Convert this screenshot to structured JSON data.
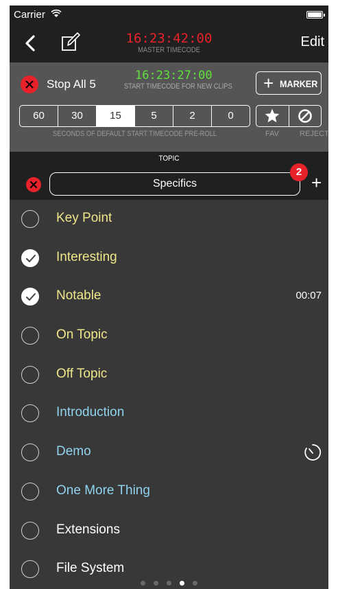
{
  "status_bar": {
    "carrier": "Carrier"
  },
  "nav": {
    "master_timecode": "16:23:42:00",
    "master_timecode_label": "MASTER TIMECODE",
    "edit_label": "Edit"
  },
  "controls": {
    "stop_all_label": "Stop All 5",
    "start_timecode": "16:23:27:00",
    "start_timecode_label": "START TIMECODE FOR NEW CLIPS",
    "marker_label": "MARKER",
    "preroll_options": [
      "60",
      "30",
      "15",
      "5",
      "2",
      "0"
    ],
    "preroll_selected": "15",
    "preroll_label": "SECONDS OF DEFAULT START TIMECODE PRE-ROLL",
    "fav_label": "FAV",
    "reject_label": "REJECT"
  },
  "topic": {
    "heading": "TOPIC",
    "value": "Specifics",
    "badge_count": "2"
  },
  "items": [
    {
      "label": "Key Point",
      "checked": false,
      "color": "#f0e68a",
      "time": "",
      "timer": false
    },
    {
      "label": "Interesting",
      "checked": true,
      "color": "#f0e68a",
      "time": "",
      "timer": false
    },
    {
      "label": "Notable",
      "checked": true,
      "color": "#f0e68a",
      "time": "00:07",
      "timer": false
    },
    {
      "label": "On Topic",
      "checked": false,
      "color": "#f0e68a",
      "time": "",
      "timer": false
    },
    {
      "label": "Off Topic",
      "checked": false,
      "color": "#f0e68a",
      "time": "",
      "timer": false
    },
    {
      "label": "Introduction",
      "checked": false,
      "color": "#8fd3ee",
      "time": "",
      "timer": false
    },
    {
      "label": "Demo",
      "checked": false,
      "color": "#8fd3ee",
      "time": "",
      "timer": true
    },
    {
      "label": "One More Thing",
      "checked": false,
      "color": "#8fd3ee",
      "time": "",
      "timer": false
    },
    {
      "label": "Extensions",
      "checked": false,
      "color": "#ffffff",
      "time": "",
      "timer": false
    },
    {
      "label": "File System",
      "checked": false,
      "color": "#ffffff",
      "time": "",
      "timer": false
    }
  ],
  "pager": {
    "pages": 5,
    "current": 4
  },
  "colors": {
    "accent_red": "#e8222a",
    "timecode_green": "#5fe33a",
    "topic_yellow": "#f0e68a",
    "topic_blue": "#8fd3ee"
  }
}
